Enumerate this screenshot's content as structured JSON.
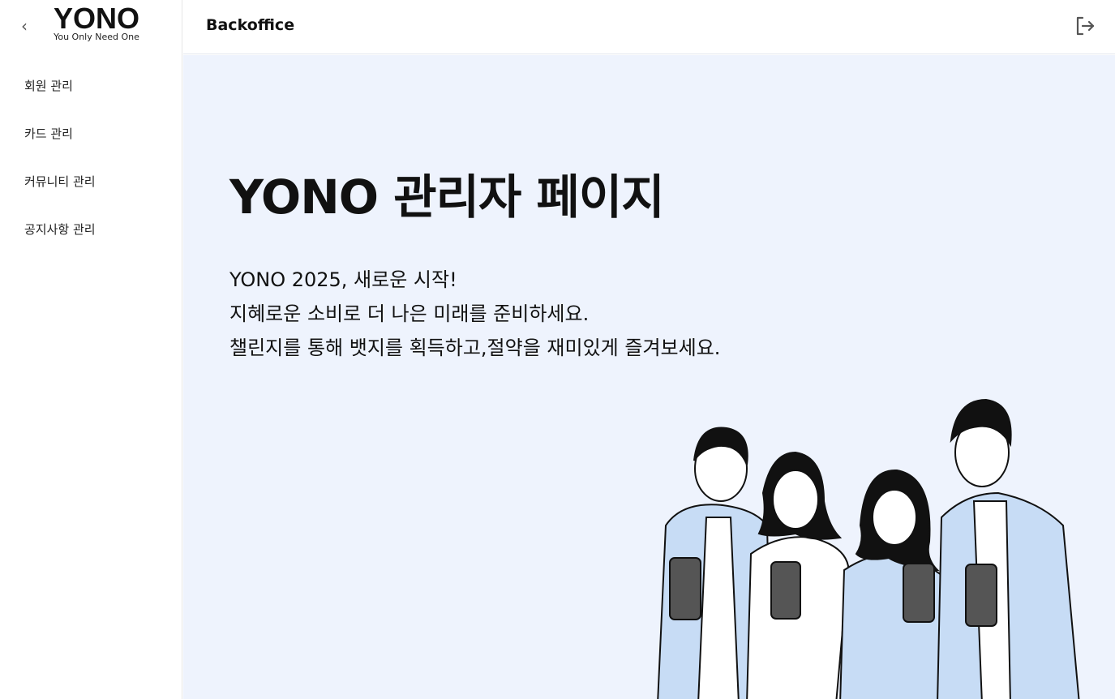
{
  "sidebar": {
    "back_icon": "chevron-left-icon",
    "logo": {
      "title": "YONO",
      "tagline": "You Only Need One"
    },
    "items": [
      {
        "label": "회원 관리"
      },
      {
        "label": "카드 관리"
      },
      {
        "label": "커뮤니티 관리"
      },
      {
        "label": "공지사항 관리"
      }
    ]
  },
  "header": {
    "title": "Backoffice",
    "logout_icon": "logout-icon"
  },
  "main": {
    "heading": "YONO 관리자 페이지",
    "lines": [
      "YONO 2025, 새로운 시작!",
      "지혜로운 소비로 더 나은 미래를 준비하세요.",
      "챌린지를 통해 뱃지를 획득하고,절약을 재미있게 즐겨보세요."
    ]
  },
  "colors": {
    "background": "#eef3fd",
    "shirt": "#c7dcf5"
  }
}
